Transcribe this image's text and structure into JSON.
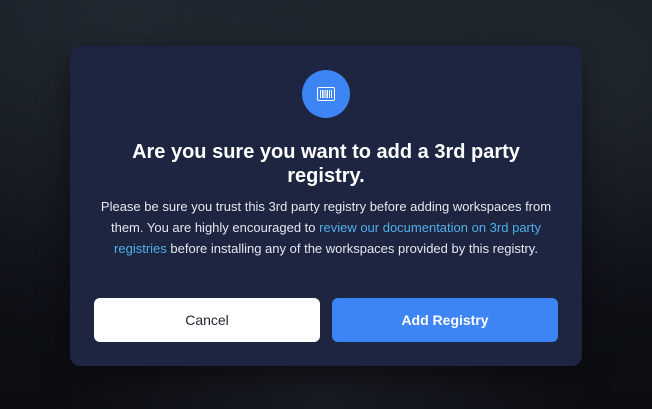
{
  "modal": {
    "icon": "barcode-icon",
    "title": "Are you sure you want to add a 3rd party registry.",
    "description": {
      "before_link": "Please be sure you trust this 3rd party registry before adding workspaces from them. You are highly encouraged to ",
      "link_text": "review our documentation on 3rd party registries",
      "after_link": " before installing any of the workspaces provided by this registry."
    },
    "cancel_label": "Cancel",
    "add_label": "Add Registry"
  },
  "colors": {
    "modal_bg": "#1e2540",
    "accent": "#3d84f5",
    "link": "#4fb0ea"
  }
}
